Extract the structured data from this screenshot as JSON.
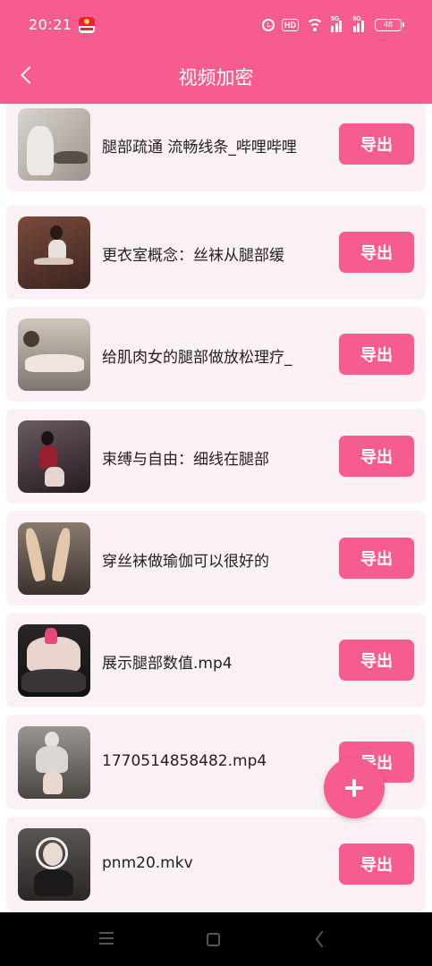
{
  "status_bar": {
    "time": "20:21",
    "hd_label": "HD",
    "signal_label_1": "5G",
    "signal_label_2": "5G",
    "battery": "48"
  },
  "header": {
    "title": "视频加密",
    "back_icon": "chevron-left-icon"
  },
  "colors": {
    "accent": "#f75c8e",
    "card_background": "#fbf0f5",
    "text": "#222222"
  },
  "videos": [
    {
      "title": "腿部疏通 流畅线条_哔哩哔哩",
      "export_label": "导出"
    },
    {
      "title": "更衣室概念：丝袜从腿部缓",
      "export_label": "导出"
    },
    {
      "title": "给肌肉女的腿部做放松理疗_",
      "export_label": "导出"
    },
    {
      "title": "束缚与自由：细线在腿部",
      "export_label": "导出"
    },
    {
      "title": "穿丝袜做瑜伽可以很好的",
      "export_label": "导出"
    },
    {
      "title": "展示腿部数值.mp4",
      "export_label": "导出"
    },
    {
      "title": "1770514858482.mp4",
      "export_label": "导出"
    },
    {
      "title": "pnm20.mkv",
      "export_label": "导出"
    }
  ],
  "fab": {
    "icon": "plus-icon"
  },
  "nav_bar": {
    "icons": [
      "menu-icon",
      "home-icon",
      "back-icon"
    ]
  }
}
